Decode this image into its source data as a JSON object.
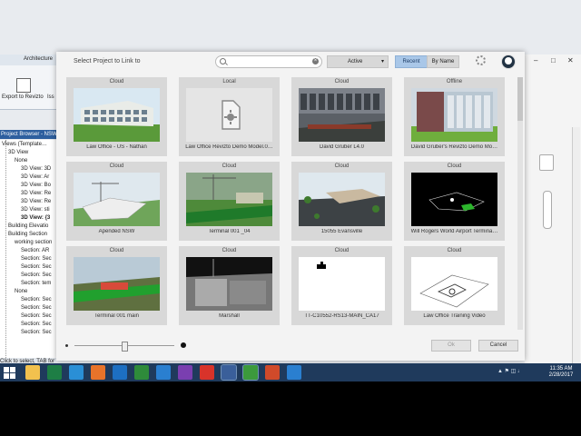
{
  "app": {
    "ribbon_tab": "Architecture",
    "export_label": "Export to Revizto",
    "export_label_2": "Iss",
    "project_browser_title": "Project Browser - NSW",
    "status_text": "Click to select, TAB for alternates, CTRL adds, SHIFT unselects."
  },
  "tree": [
    {
      "text": "Views (Template…",
      "indent": 0
    },
    {
      "text": "3D View",
      "indent": 1
    },
    {
      "text": "None",
      "indent": 2
    },
    {
      "text": "3D View: 3D",
      "indent": 3
    },
    {
      "text": "3D View: Ar",
      "indent": 3
    },
    {
      "text": "3D View: Bo",
      "indent": 3
    },
    {
      "text": "3D View: Re",
      "indent": 3
    },
    {
      "text": "3D View: Re",
      "indent": 3
    },
    {
      "text": "3D View: sti",
      "indent": 3
    },
    {
      "text": "3D View: {3",
      "indent": 3,
      "bold": true
    },
    {
      "text": "Building Elevatio",
      "indent": 1
    },
    {
      "text": "Building Section",
      "indent": 1
    },
    {
      "text": "working section",
      "indent": 2
    },
    {
      "text": "Section: AR",
      "indent": 3
    },
    {
      "text": "Section: Sec",
      "indent": 3
    },
    {
      "text": "Section: Sec",
      "indent": 3
    },
    {
      "text": "Section: Sec",
      "indent": 3
    },
    {
      "text": "Section: tem",
      "indent": 3
    },
    {
      "text": "None",
      "indent": 2
    },
    {
      "text": "Section: Sec",
      "indent": 3
    },
    {
      "text": "Section: Sec",
      "indent": 3
    },
    {
      "text": "Section: Sec",
      "indent": 3
    },
    {
      "text": "Section: Sec",
      "indent": 3
    },
    {
      "text": "Section: Sec",
      "indent": 3
    }
  ],
  "dialog": {
    "title": "Select Project to Link to",
    "search_placeholder": "",
    "filter_value": "Active",
    "recent_label": "Recent",
    "byname_label": "By Name",
    "ok_label": "Ok",
    "cancel_label": "Cancel",
    "projects": [
      {
        "status": "Cloud",
        "name": "Law Office - US - Nathan",
        "thumb": "office"
      },
      {
        "status": "Local",
        "name": "Law Office Revizto Demo Model.0…",
        "thumb": "placeholder"
      },
      {
        "status": "Cloud",
        "name": "David Gruber L4.0",
        "thumb": "interior"
      },
      {
        "status": "Offline",
        "name": "David Gruber's Revizto Demo Mo…",
        "thumb": "brick"
      },
      {
        "status": "Cloud",
        "name": "Apended NSW",
        "thumb": "site"
      },
      {
        "status": "Cloud",
        "name": "Terminal 001 _04",
        "thumb": "terminal"
      },
      {
        "status": "Cloud",
        "name": "15055 Evansville",
        "thumb": "campus"
      },
      {
        "status": "Cloud",
        "name": "Will Rogers World Airport Termina…",
        "thumb": "dark"
      },
      {
        "status": "Cloud",
        "name": "Terminal 001 main",
        "thumb": "green"
      },
      {
        "status": "Cloud",
        "name": "Marshall",
        "thumb": "marshall"
      },
      {
        "status": "Cloud",
        "name": "TT-C10552-RS13-MAIN_CA17",
        "thumb": "white"
      },
      {
        "status": "Cloud",
        "name": "Law Office Training Video",
        "thumb": "wire"
      }
    ]
  },
  "taskbar": {
    "apps": [
      "file-explorer",
      "excel",
      "internet-explorer",
      "firefox",
      "outlook",
      "navisworks",
      "teamviewer",
      "search-app",
      "revizto",
      "revit",
      "camtasia",
      "powerpoint",
      "revizto-viewer"
    ],
    "time": "11:35 AM",
    "date": "2/28/2017"
  },
  "colors": {
    "accent": "#a9c7e8",
    "taskbar": "#1f3a5c",
    "browser_header": "#2d5f9f"
  }
}
